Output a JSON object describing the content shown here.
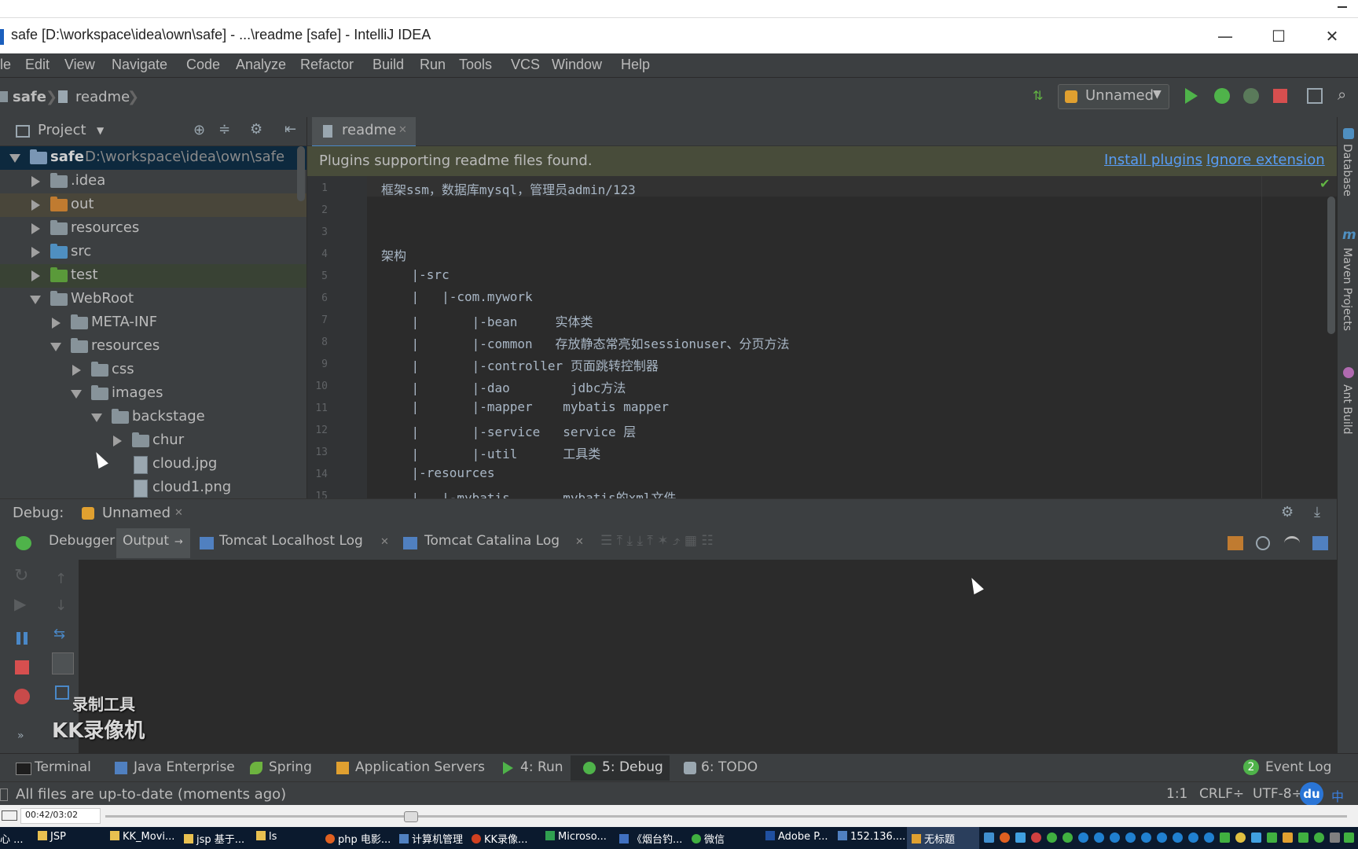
{
  "window": {
    "title": "safe [D:\\workspace\\idea\\own\\safe] - ...\\readme [safe] - IntelliJ IDEA",
    "minimize": "—",
    "maximize": "☐",
    "close": "✕"
  },
  "menu": [
    "le",
    "Edit",
    "View",
    "Navigate",
    "Code",
    "Analyze",
    "Refactor",
    "Build",
    "Run",
    "Tools",
    "VCS",
    "Window",
    "Help"
  ],
  "breadcrumb": [
    "safe",
    "readme"
  ],
  "run_config": "Unnamed",
  "project_panel": {
    "title": "Project",
    "tree": [
      {
        "label": "safe",
        "path": "D:\\workspace\\idea\\own\\safe",
        "depth": 0,
        "expanded": true,
        "color": "#7a96b4"
      },
      {
        "label": ".idea",
        "depth": 1,
        "expanded": false,
        "color": "#87939a"
      },
      {
        "label": "out",
        "depth": 1,
        "expanded": false,
        "color": "#c07b30"
      },
      {
        "label": "resources",
        "depth": 1,
        "expanded": false,
        "color": "#87939a"
      },
      {
        "label": "src",
        "depth": 1,
        "expanded": false,
        "color": "#4f8fc0"
      },
      {
        "label": "test",
        "depth": 1,
        "expanded": false,
        "color": "#5a9a3a"
      },
      {
        "label": "WebRoot",
        "depth": 1,
        "expanded": true,
        "color": "#87939a"
      },
      {
        "label": "META-INF",
        "depth": 2,
        "expanded": false,
        "color": "#87939a"
      },
      {
        "label": "resources",
        "depth": 2,
        "expanded": true,
        "color": "#87939a"
      },
      {
        "label": "css",
        "depth": 3,
        "expanded": false,
        "color": "#87939a"
      },
      {
        "label": "images",
        "depth": 3,
        "expanded": true,
        "color": "#87939a"
      },
      {
        "label": "backstage",
        "depth": 4,
        "expanded": true,
        "color": "#87939a"
      },
      {
        "label": "chur",
        "depth": 5,
        "expanded": false,
        "color": "#87939a"
      },
      {
        "label": "cloud.jpg",
        "depth": 5,
        "file": true
      },
      {
        "label": "cloud1.png",
        "depth": 5,
        "file": true
      }
    ]
  },
  "editor": {
    "tab": "readme",
    "banner_text": "Plugins supporting readme files found.",
    "banner_actions": [
      "Install plugins",
      "Ignore extension"
    ],
    "lines": [
      "框架ssm，数据库mysql，管理员admin/123",
      "",
      "",
      "架构",
      "    |-src",
      "    |   |-com.mywork",
      "    |       |-bean     实体类",
      "    |       |-common   存放静态常亮如sessionuser、分页方法",
      "    |       |-controller 页面跳转控制器",
      "    |       |-dao        jdbc方法",
      "    |       |-mapper    mybatis mapper",
      "    |       |-service   service 层",
      "    |       |-util      工具类",
      "    |-resources",
      "    |   |-mybatis       mybatis的xml文件"
    ]
  },
  "right_tools": [
    "Database",
    "Maven Projects",
    "Ant Build"
  ],
  "debug": {
    "label": "Debug:",
    "session": "Unnamed",
    "tabs": [
      "Debugger",
      "Output",
      "Tomcat Localhost Log",
      "Tomcat Catalina Log"
    ]
  },
  "watermark": {
    "line1": "录制工具",
    "line2": "KK录像机"
  },
  "tool_windows": [
    {
      "label": "Terminal"
    },
    {
      "label": "Java Enterprise"
    },
    {
      "label": "Spring"
    },
    {
      "label": "Application Servers"
    },
    {
      "label": "4: Run"
    },
    {
      "label": "5: Debug"
    },
    {
      "label": "6: TODO"
    }
  ],
  "event_log": {
    "count": "2",
    "label": "Event Log"
  },
  "status": {
    "message": "All files are up-to-date (moments ago)",
    "position": "1:1",
    "line_sep": "CRLF÷",
    "encoding": "UTF-8÷"
  },
  "player": {
    "time": "00:42/03:02"
  },
  "taskbar": [
    {
      "label": "心 ...",
      "color": "#e0b040"
    },
    {
      "label": "JSP",
      "color": "#e8c050"
    },
    {
      "label": "KK_Movi...",
      "color": "#e8c050"
    },
    {
      "label": "jsp 基于...",
      "color": "#e8c050"
    },
    {
      "label": "ls",
      "color": "#e8c050"
    },
    {
      "label": "php 电影...",
      "color": "#e06020"
    },
    {
      "label": "计算机管理",
      "color": "#5080c0"
    },
    {
      "label": "KK录像...",
      "color": "#d04020"
    },
    {
      "label": "Microso...",
      "color": "#30a050"
    },
    {
      "label": "《烟台钓...",
      "color": "#4070c0"
    },
    {
      "label": "微信",
      "color": "#40b040"
    },
    {
      "label": "Adobe P...",
      "color": "#2050a0"
    },
    {
      "label": "152.136....",
      "color": "#5080c0"
    },
    {
      "label": "无标题",
      "color": "#e0a030"
    }
  ],
  "tray_lang": "中"
}
